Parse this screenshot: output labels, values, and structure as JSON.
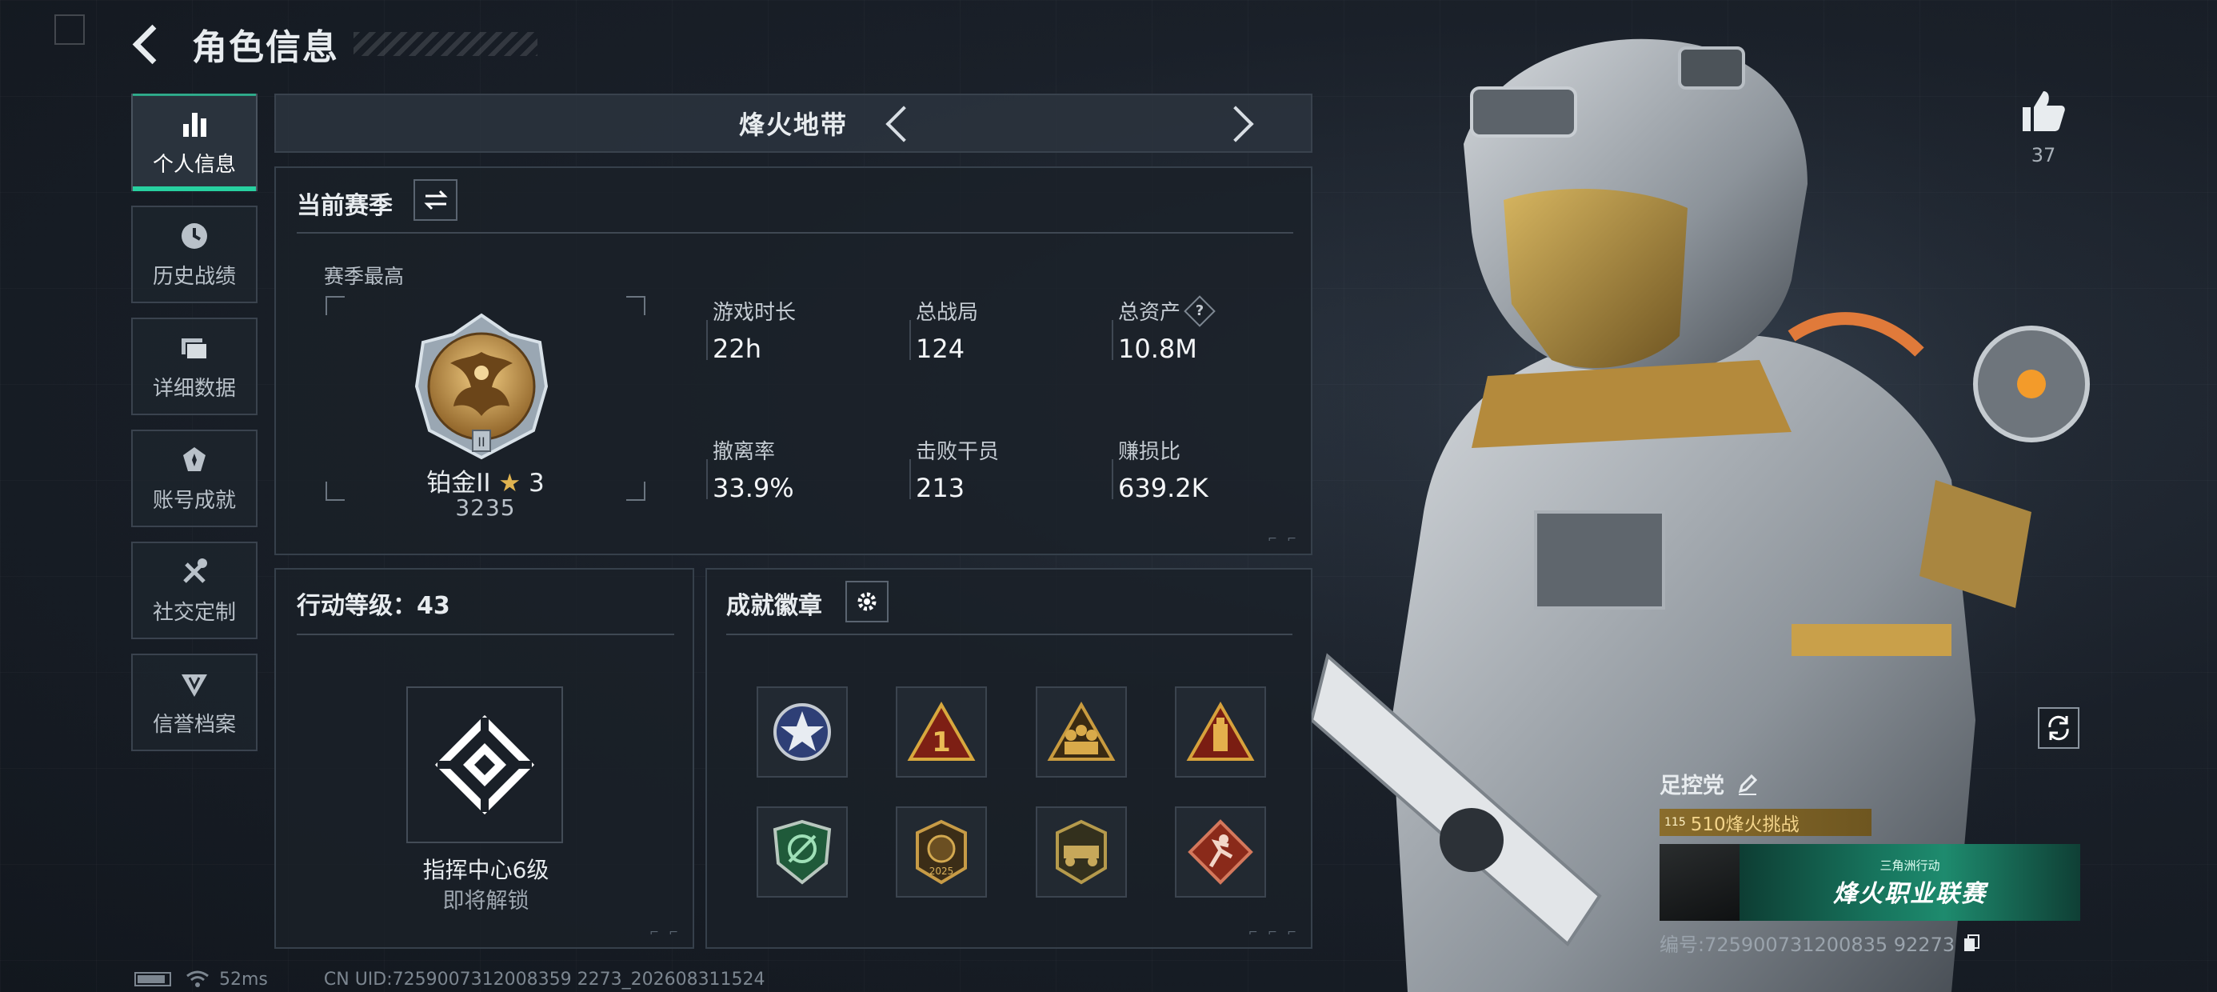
{
  "header": {
    "title": "角色信息"
  },
  "sidebar": {
    "items": [
      {
        "label": "个人信息",
        "icon": "bar-chart-icon",
        "active": true
      },
      {
        "label": "历史战绩",
        "icon": "history-clock-icon",
        "active": false
      },
      {
        "label": "详细数据",
        "icon": "folder-icon",
        "active": false
      },
      {
        "label": "账号成就",
        "icon": "achievement-medal-icon",
        "active": false
      },
      {
        "label": "社交定制",
        "icon": "tools-icon",
        "active": false
      },
      {
        "label": "信誉档案",
        "icon": "reputation-shield-icon",
        "active": false
      }
    ]
  },
  "mode_selector": {
    "title": "烽火地带"
  },
  "season": {
    "title": "当前赛季",
    "best_label": "赛季最高",
    "rank_name": "铂金II",
    "rank_stars": "3",
    "rank_score": "3235",
    "stats": [
      {
        "label": "游戏时长",
        "value": "22h"
      },
      {
        "label": "总战局",
        "value": "124"
      },
      {
        "label": "总资产",
        "value": "10.8M",
        "help": "?"
      },
      {
        "label": "撤离率",
        "value": "33.9%"
      },
      {
        "label": "击败干员",
        "value": "213"
      },
      {
        "label": "赚损比",
        "value": "639.2K"
      }
    ]
  },
  "action_level": {
    "title": "行动等级：43",
    "command_center": "指挥中心6级",
    "status": "即将解锁"
  },
  "achievements": {
    "title": "成就徽章",
    "badges": [
      {
        "icon": "star-emblem-badge-icon"
      },
      {
        "icon": "triangle-number-one-badge-icon"
      },
      {
        "icon": "triangle-squad-badge-icon"
      },
      {
        "icon": "triangle-tower-badge-icon"
      },
      {
        "icon": "green-shield-badge-icon"
      },
      {
        "icon": "year-2025-badge-icon"
      },
      {
        "icon": "vehicle-badge-icon"
      },
      {
        "icon": "diamond-runner-badge-icon"
      }
    ]
  },
  "status_bar": {
    "ping": "52ms",
    "uid": "CN UID:7259007312008359 2273_202608311524"
  },
  "character": {
    "likes": "37",
    "player_name": "足控党",
    "title_tag": "510烽火挑战",
    "title_emblem": "115",
    "banner_sub": "三角洲行动",
    "banner_main": "烽火职业联赛",
    "player_id": "编号:725900731200835 92273"
  },
  "colors": {
    "accent": "#27d0a0",
    "gold": "#e0b350",
    "panel_bg": "#1a2028"
  }
}
